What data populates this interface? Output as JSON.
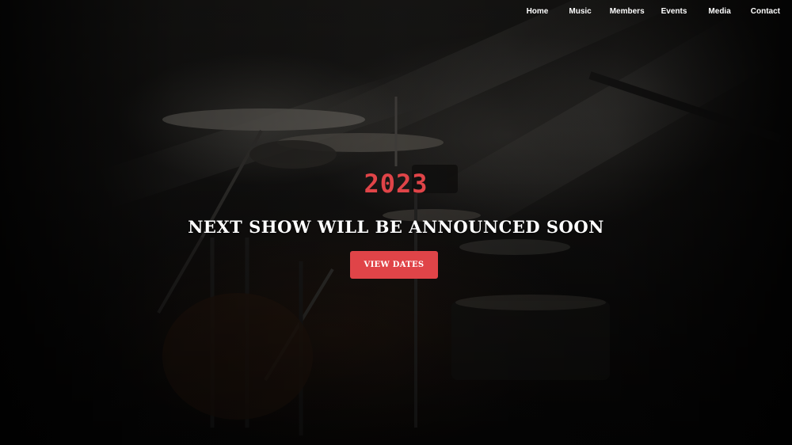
{
  "nav": {
    "items": [
      {
        "label": "Home"
      },
      {
        "label": "Music"
      },
      {
        "label": "Members"
      },
      {
        "label": "Events"
      },
      {
        "label": "Media"
      },
      {
        "label": "Contact"
      }
    ]
  },
  "hero": {
    "year": "2023",
    "headline": "NEXT SHOW WILL BE ANNOUNCED SOON",
    "cta_label": "VIEW DATES",
    "background_image": "drum-kit-stage-photo"
  },
  "colors": {
    "accent": "#e04448",
    "text": "#ffffff",
    "background": "#0a0a0a"
  }
}
